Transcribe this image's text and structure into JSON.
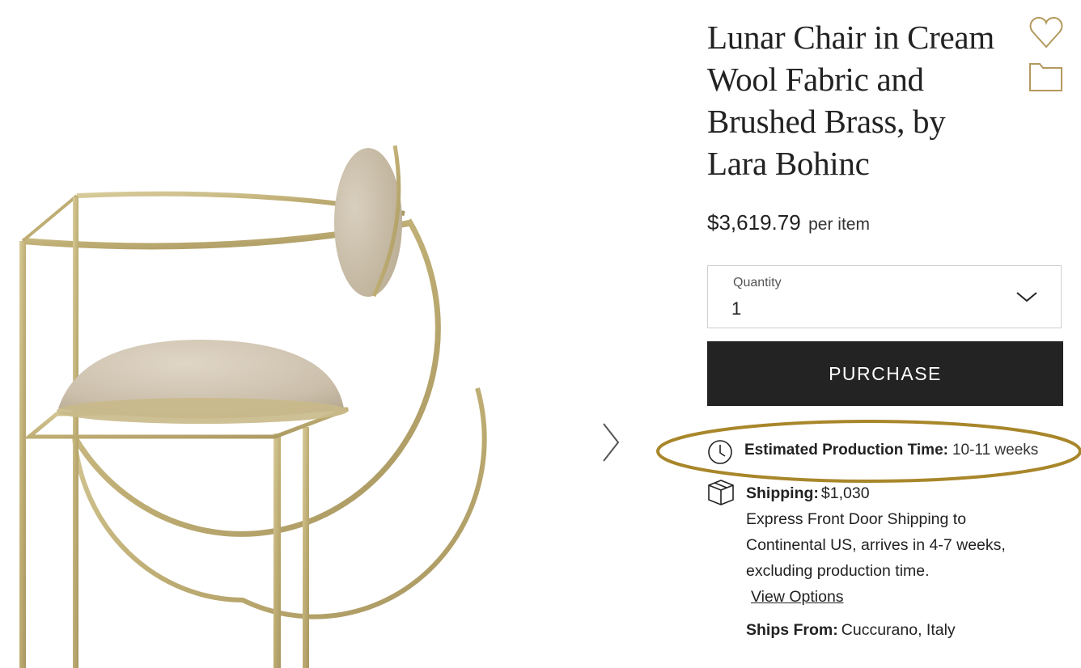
{
  "product": {
    "title": "Lunar Chair in Cream Wool Fabric and Brushed Brass, by Lara Bohinc",
    "price": "$3,619.79",
    "price_unit": "per item"
  },
  "quantity": {
    "label": "Quantity",
    "value": "1"
  },
  "purchase_label": "PURCHASE",
  "production": {
    "label": "Estimated Production Time:",
    "value": "10-11 weeks"
  },
  "shipping": {
    "label": "Shipping:",
    "value": "$1,030",
    "description": "Express Front Door Shipping to Continental US, arrives in 4-7 weeks, excluding production time.",
    "view_options": "View Options"
  },
  "ships_from": {
    "label": "Ships From:",
    "value": "Cuccurano, Italy"
  },
  "icons": {
    "favorite": "heart-icon",
    "collection": "folder-icon",
    "next": "chevron-right-icon",
    "dropdown": "chevron-down-icon",
    "production": "clock-icon",
    "shipping": "package-icon"
  },
  "colors": {
    "accent_gold": "#b3995d",
    "highlight": "#a8862a",
    "button_bg": "#232323",
    "text": "#222222"
  }
}
